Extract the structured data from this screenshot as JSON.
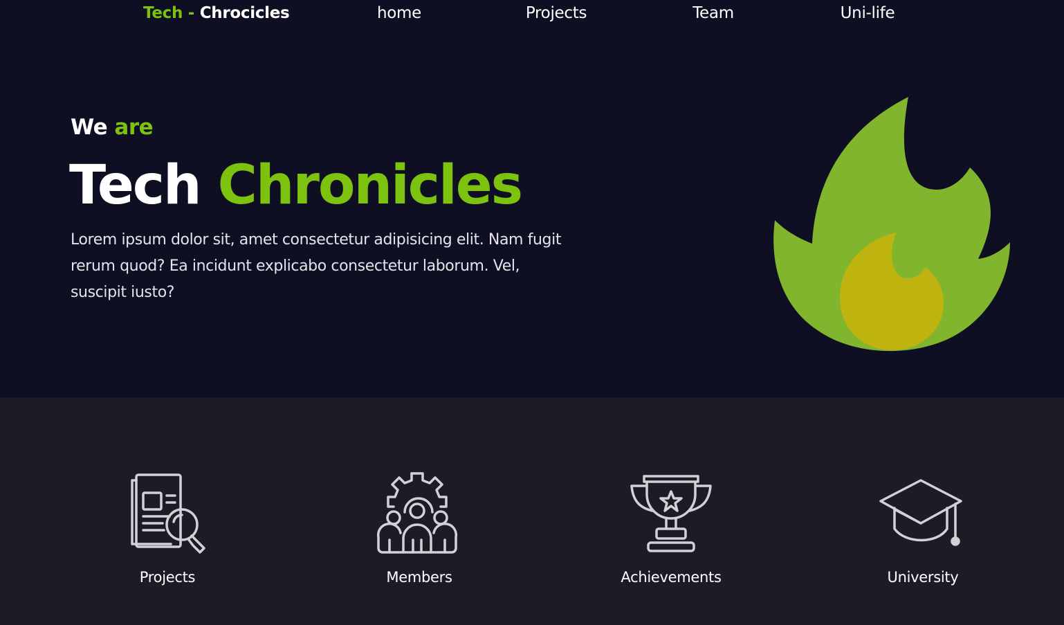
{
  "nav": {
    "brand_prefix": "Tech -",
    "brand_suffix": "Chrocicles",
    "links": [
      "home",
      "Projects",
      "Team",
      "Uni-life"
    ]
  },
  "hero": {
    "intro_plain": "We",
    "intro_accent": "are",
    "title_plain": "Tech",
    "title_accent": "Chronicles",
    "lead": "Lorem ipsum dolor sit, amet consectetur adipisicing elit. Nam fugit rerum quod? Ea incidunt explicabo consectetur laborum. Vel, suscipit iusto?",
    "illustration_icon": "fire-icon"
  },
  "features": [
    {
      "label": "Projects",
      "icon": "document-search-icon"
    },
    {
      "label": "Members",
      "icon": "team-gear-icon"
    },
    {
      "label": "Achievements",
      "icon": "trophy-icon"
    },
    {
      "label": "University",
      "icon": "graduation-cap-icon"
    }
  ],
  "colors": {
    "background": "#0f0f23",
    "section_background": "#1c1c27",
    "accent": "#7cc20f",
    "flame_outer": "#82b52e",
    "flame_inner": "#bfb310",
    "icon_stroke": "#d2d2d6"
  }
}
